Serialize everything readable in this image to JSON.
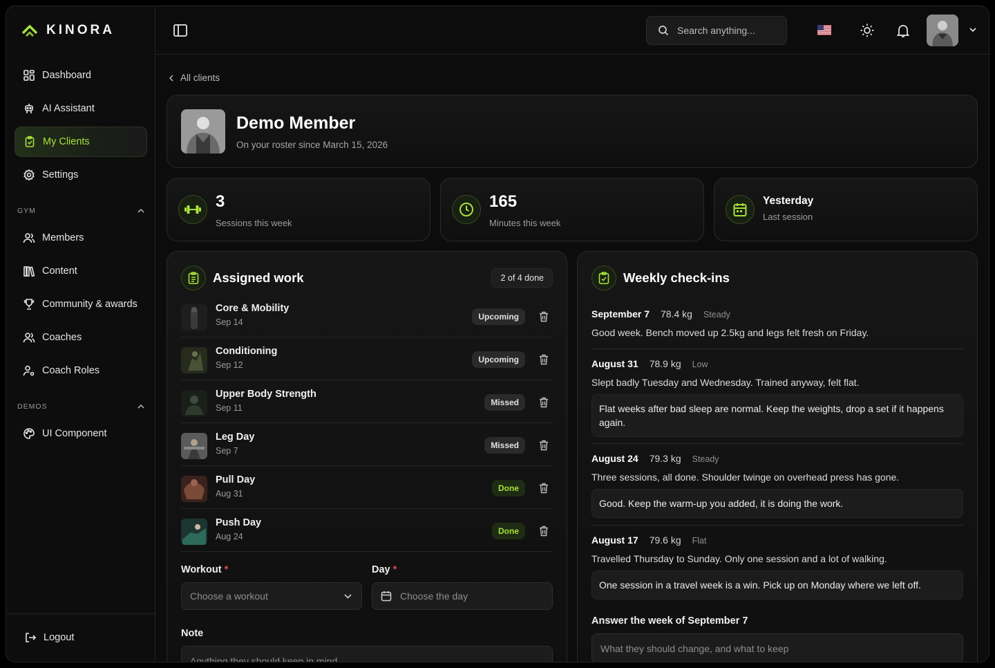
{
  "brand": {
    "name": "KINORA"
  },
  "sidebar": {
    "primary": [
      {
        "label": "Dashboard",
        "icon": "dashboard-grid-icon"
      },
      {
        "label": "AI Assistant",
        "icon": "robot-icon"
      },
      {
        "label": "My Clients",
        "icon": "clipboard-icon",
        "active": true
      },
      {
        "label": "Settings",
        "icon": "gear-icon"
      }
    ],
    "gym_label": "GYM",
    "gym": [
      {
        "label": "Members",
        "icon": "users-icon"
      },
      {
        "label": "Content",
        "icon": "library-icon"
      },
      {
        "label": "Community & awards",
        "icon": "trophy-icon"
      },
      {
        "label": "Coaches",
        "icon": "users-icon"
      },
      {
        "label": "Coach Roles",
        "icon": "user-gear-icon"
      }
    ],
    "demos_label": "DEMOS",
    "demos": [
      {
        "label": "UI Component",
        "icon": "palette-icon"
      }
    ],
    "logout": "Logout"
  },
  "topbar": {
    "search_placeholder": "Search anything..."
  },
  "breadcrumb": {
    "back": "All clients"
  },
  "profile": {
    "name": "Demo Member",
    "since": "On your roster since March 15, 2026"
  },
  "stats": [
    {
      "value": "3",
      "label": "Sessions this week",
      "icon": "dumbbell-icon"
    },
    {
      "value": "165",
      "label": "Minutes this week",
      "icon": "clock-icon"
    },
    {
      "value": "Yesterday",
      "label": "Last session",
      "icon": "calendar-icon"
    }
  ],
  "assigned": {
    "title": "Assigned work",
    "progress": "2 of 4 done",
    "items": [
      {
        "title": "Core & Mobility",
        "date": "Sep 14",
        "status": "Upcoming"
      },
      {
        "title": "Conditioning",
        "date": "Sep 12",
        "status": "Upcoming"
      },
      {
        "title": "Upper Body Strength",
        "date": "Sep 11",
        "status": "Missed"
      },
      {
        "title": "Leg Day",
        "date": "Sep 7",
        "status": "Missed"
      },
      {
        "title": "Pull Day",
        "date": "Aug 31",
        "status": "Done"
      },
      {
        "title": "Push Day",
        "date": "Aug 24",
        "status": "Done"
      }
    ],
    "workout_label": "Workout",
    "workout_placeholder": "Choose a workout",
    "day_label": "Day",
    "day_placeholder": "Choose the day",
    "note_label": "Note",
    "note_placeholder": "Anything they should keep in mind"
  },
  "checkins": {
    "title": "Weekly check-ins",
    "entries": [
      {
        "date": "September 7",
        "weight": "78.4 kg",
        "trend": "Steady",
        "text": "Good week. Bench moved up 2.5kg and legs felt fresh on Friday.",
        "reply": ""
      },
      {
        "date": "August 31",
        "weight": "78.9 kg",
        "trend": "Low",
        "text": "Slept badly Tuesday and Wednesday. Trained anyway, felt flat.",
        "reply": "Flat weeks after bad sleep are normal. Keep the weights, drop a set if it happens again."
      },
      {
        "date": "August 24",
        "weight": "79.3 kg",
        "trend": "Steady",
        "text": "Three sessions, all done. Shoulder twinge on overhead press has gone.",
        "reply": "Good. Keep the warm-up you added, it is doing the work."
      },
      {
        "date": "August 17",
        "weight": "79.6 kg",
        "trend": "Flat",
        "text": "Travelled Thursday to Sunday. Only one session and a lot of walking.",
        "reply": "One session in a travel week is a win. Pick up on Monday where we left off."
      }
    ],
    "answer_label": "Answer the week of September 7",
    "answer_placeholder": "What they should change, and what to keep"
  },
  "colors": {
    "accent": "#a8e23b",
    "background": "#0c0c0c"
  }
}
